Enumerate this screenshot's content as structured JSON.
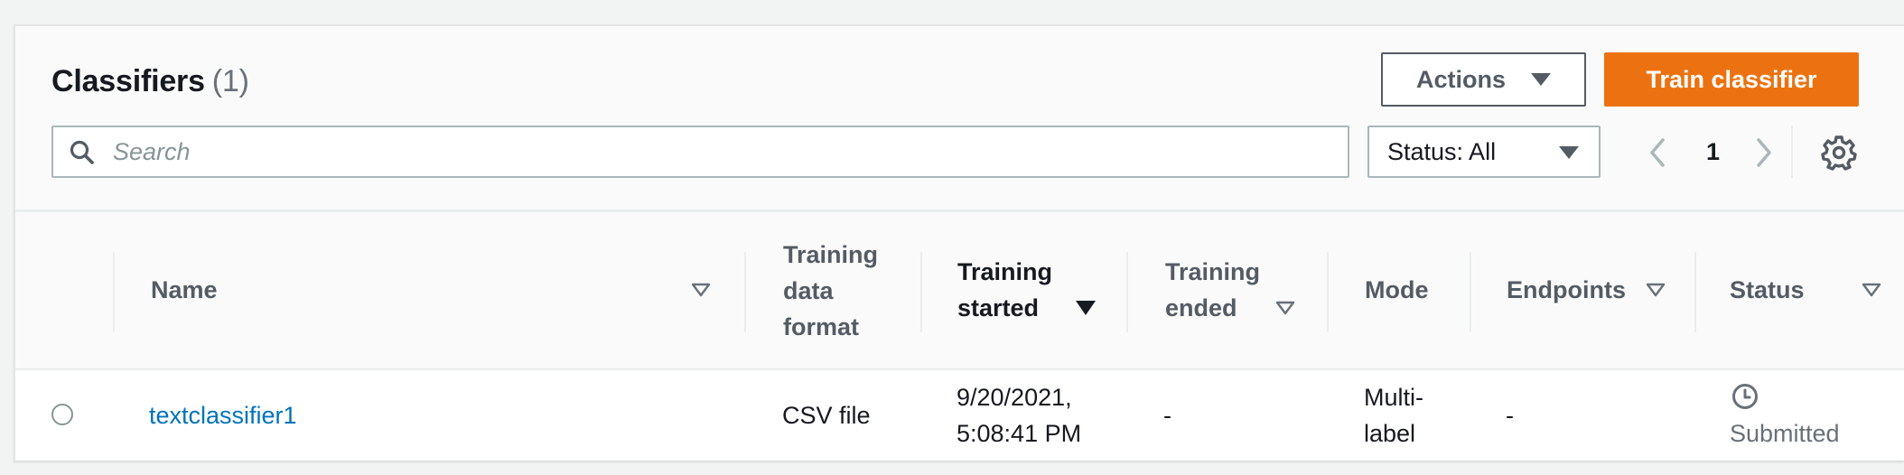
{
  "header": {
    "title": "Classifiers",
    "count": "(1)",
    "actions_label": "Actions",
    "train_label": "Train classifier"
  },
  "search": {
    "placeholder": "Search",
    "value": ""
  },
  "filter": {
    "status_label": "Status: All"
  },
  "pagination": {
    "current_page": "1"
  },
  "table": {
    "columns": [
      {
        "lines": [
          "Name"
        ]
      },
      {
        "lines": [
          "Training",
          "data",
          "format"
        ]
      },
      {
        "lines": [
          "Training",
          "started"
        ]
      },
      {
        "lines": [
          "Training",
          "ended"
        ]
      },
      {
        "lines": [
          "Mode"
        ]
      },
      {
        "lines": [
          "Endpoints"
        ]
      },
      {
        "lines": [
          "Status"
        ]
      }
    ],
    "rows": [
      {
        "name": "textclassifier1",
        "training_data_format": "CSV file",
        "training_started": [
          "9/20/2021,",
          "5:08:41 PM"
        ],
        "training_ended": "-",
        "mode": [
          "Multi-",
          "label"
        ],
        "endpoints": "-",
        "status": "Submitted",
        "status_icon": "clock-icon"
      }
    ]
  },
  "colors": {
    "primary_button": "#ec7211",
    "link": "#0073bb",
    "border": "#aab7b8",
    "text_secondary": "#545b64"
  },
  "icons": {
    "search": "search-icon",
    "settings": "gear-icon",
    "prev": "chevron-left-icon",
    "next": "chevron-right-icon",
    "sort": "sort-caret-icon",
    "dropdown": "caret-down-icon"
  }
}
